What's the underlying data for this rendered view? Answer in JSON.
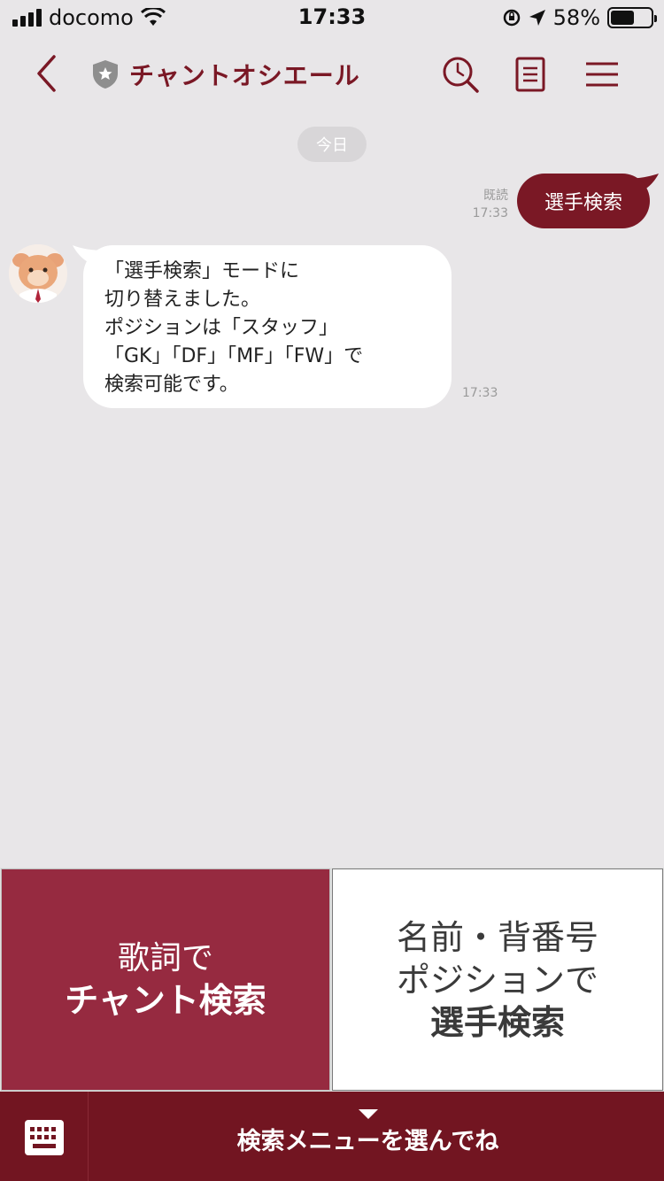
{
  "status_bar": {
    "carrier": "docomo",
    "time": "17:33",
    "battery_percent": "58%",
    "battery_level": 0.58,
    "icons": [
      "signal-icon",
      "wifi-icon",
      "orientation-lock-icon",
      "location-icon",
      "battery-icon"
    ]
  },
  "header": {
    "title": "チャントオシエール",
    "icons": [
      "back-icon",
      "verified-badge-icon",
      "search-icon",
      "note-icon",
      "menu-icon"
    ]
  },
  "chat": {
    "date_chip": "今日",
    "sent": {
      "read_label": "既読",
      "time": "17:33",
      "text": "選手検索"
    },
    "received": {
      "lines": [
        "「選手検索」モードに",
        "切り替えました。",
        "ポジションは「スタッフ」",
        "「GK」「DF」「MF」「FW」で",
        "検索可能です。"
      ],
      "time": "17:33"
    }
  },
  "rich_menu": {
    "left": {
      "line1": "歌詞で",
      "line2": "チャント検索"
    },
    "right": {
      "line1": "名前・背番号",
      "line2": "ポジションで",
      "line3": "選手検索"
    }
  },
  "bottom_bar": {
    "label": "検索メニューを選んでね",
    "icons": [
      "keyboard-icon",
      "caret-down-icon"
    ]
  },
  "colors": {
    "brand": "#7a1825",
    "tile_left": "#962a40",
    "bottom_bar": "#721521",
    "chat_background": "#e8e6e8"
  }
}
